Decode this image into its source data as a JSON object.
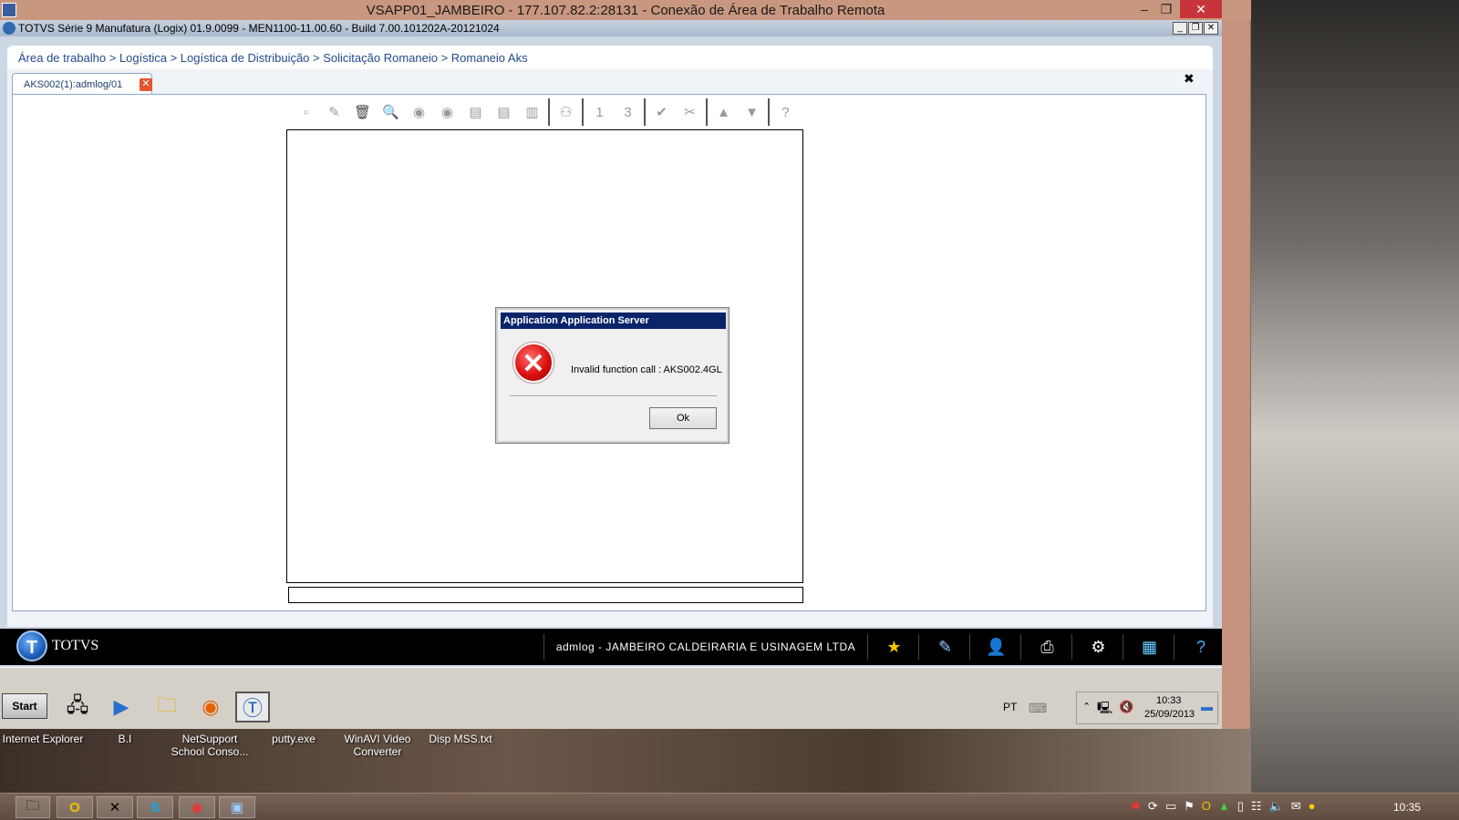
{
  "rdp": {
    "title": "VSAPP01_JAMBEIRO - 177.107.82.2:28131 - Conexão de Área de Trabalho Remota",
    "minimize": "–",
    "restore": "❐",
    "close": "✕"
  },
  "logix": {
    "title": "TOTVS Série 9 Manufatura (Logix) 01.9.0099  -  MEN1100-11.00.60 - Build 7.00.101202A-20121024",
    "breadcrumb": "Área de trabalho > Logística > Logística de Distribuição > Solicitação Romaneio > Romaneio Aks",
    "tab_label": "AKS002(1):admlog/01"
  },
  "toolbar": {
    "buttons": [
      "new-icon",
      "edit-icon",
      "delete-icon",
      "search-icon",
      "prev-icon",
      "next-icon",
      "first-icon",
      "last-icon",
      "print-icon",
      "binoculars-icon",
      "number-one-icon",
      "number-three-icon",
      "confirm-icon",
      "tools-icon",
      "up-icon",
      "filter-icon",
      "help-icon"
    ]
  },
  "dialog": {
    "title": "Application Application Server",
    "message": "Invalid function call : AKS002.4GL",
    "ok_label": "Ok"
  },
  "totvs_bar": {
    "brand": "TOTVS",
    "user_info": "admlog - JAMBEIRO CALDEIRARIA E USINAGEM LTDA"
  },
  "remote_taskbar": {
    "start_label": "Start",
    "language": "PT",
    "time": "10:33",
    "date": "25/09/2013"
  },
  "desktop_icons": [
    {
      "label1": "Internet Explorer",
      "label2": ""
    },
    {
      "label1": "B.I",
      "label2": ""
    },
    {
      "label1": "NetSupport",
      "label2": "School Conso..."
    },
    {
      "label1": "putty.exe",
      "label2": ""
    },
    {
      "label1": "WinAVI Video",
      "label2": "Converter"
    },
    {
      "label1": "Disp MSS.txt",
      "label2": ""
    }
  ],
  "host_taskbar": {
    "clock": "10:35"
  }
}
